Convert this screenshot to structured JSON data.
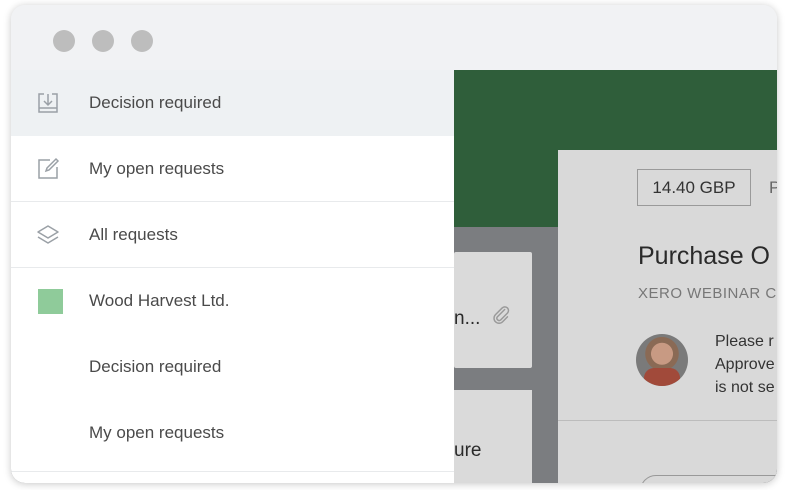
{
  "menu": {
    "items": [
      {
        "label": "Decision required",
        "icon": "inbox-download-icon",
        "active": true
      },
      {
        "label": "My open requests",
        "icon": "edit-square-icon"
      },
      {
        "label": "All requests",
        "icon": "layers-icon"
      },
      {
        "label": "Wood Harvest Ltd.",
        "icon": "organization-color-swatch",
        "color": "#8fcb9a"
      },
      {
        "label": "Decision required"
      },
      {
        "label": "My open requests"
      }
    ]
  },
  "background_app": {
    "list_snippet_1": "n...",
    "list_snippet_2": "ure",
    "detail": {
      "amount": "14.40 GBP",
      "amount_extra": "P",
      "title": "Purchase O",
      "subtitle": "XERO WEBINAR C",
      "message_lines": [
        "Please r",
        "Approve",
        "is not se"
      ]
    }
  },
  "colors": {
    "header_green": "#2f5e3a",
    "active_row": "#eef1f3",
    "org_swatch": "#8fcb9a"
  }
}
